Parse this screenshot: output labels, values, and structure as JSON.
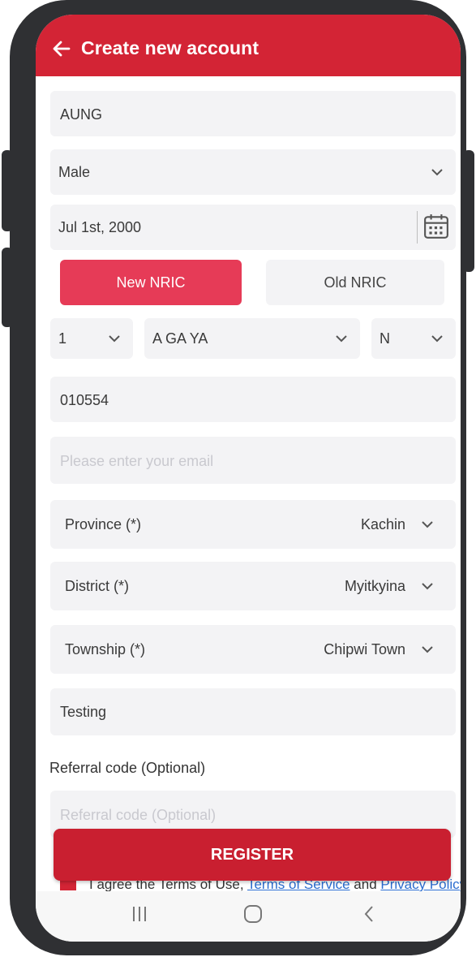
{
  "header": {
    "title": "Create new account"
  },
  "form": {
    "name_value": "AUNG",
    "gender_value": "Male",
    "dob_value": "Jul 1st, 2000",
    "nric_tabs": {
      "new": "New NRIC",
      "old": "Old NRIC",
      "selected": "New NRIC"
    },
    "nric_state": "1",
    "nric_township": "A GA YA",
    "nric_type": "N",
    "nric_number": "010554",
    "email_placeholder": "Please enter your email",
    "province": {
      "label": "Province (*)",
      "value": "Kachin"
    },
    "district": {
      "label": "District (*)",
      "value": "Myitkyina"
    },
    "township": {
      "label": "Township (*)",
      "value": "Chipwi Town"
    },
    "address_value": "Testing",
    "referral_label": "Referral code (Optional)",
    "referral_placeholder": "Referral code (Optional)"
  },
  "register_label": "REGISTER",
  "agree": {
    "prefix": "I agree the Terms of Use, ",
    "link1": "Terms of Service",
    "middle": " and ",
    "link2": "Privacy Policy"
  },
  "colors": {
    "brand": "#d32435",
    "accent": "#e63b57",
    "field_bg": "#f3f3f5"
  },
  "icons": {
    "back": "arrow-left-icon",
    "calendar": "calendar-icon",
    "dropdown": "chevron-down-icon",
    "nav_recents": "recents-icon",
    "nav_home": "home-icon",
    "nav_back": "back-icon"
  }
}
